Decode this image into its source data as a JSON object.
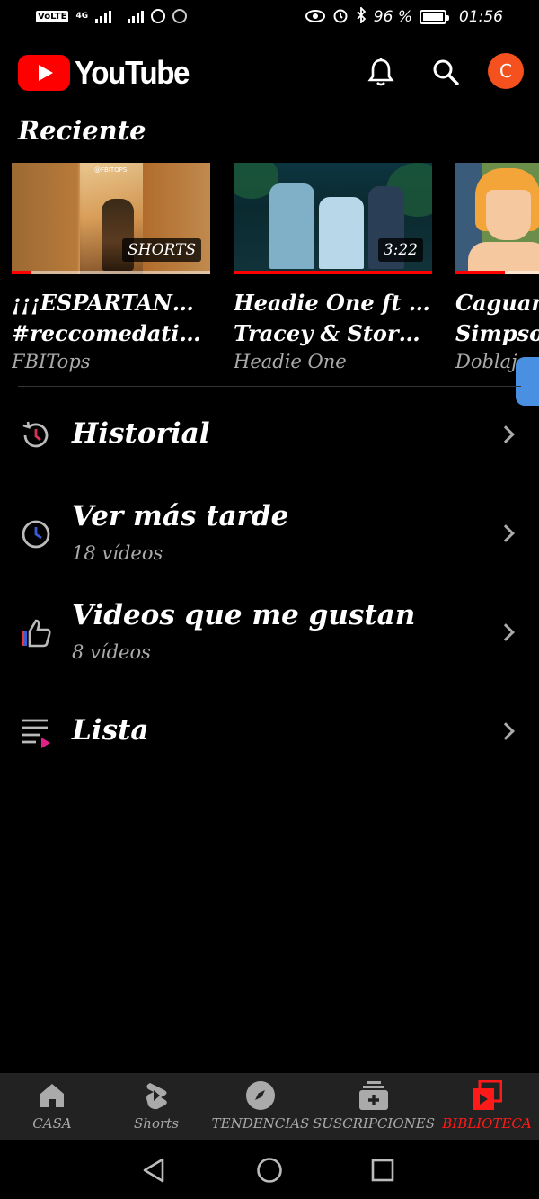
{
  "status_bar": {
    "volte": "VoLTE",
    "network": "4G",
    "battery_percent": "96 %",
    "time": "01:56"
  },
  "app_bar": {
    "logo_text": "YouTube",
    "avatar_initial": "C",
    "icons": [
      "bell-icon",
      "search-icon"
    ]
  },
  "recent": {
    "title": "Reciente",
    "videos": [
      {
        "title_line1": "¡¡¡ESPARTANOS!!!",
        "title_line2": "#reccomedation ...",
        "channel": "FBITops",
        "badge": "SHORTS",
        "watched_fraction": 0.1,
        "thumb_tag": "@FBITOPS"
      },
      {
        "title_line1": "Headie One ft AJ",
        "title_line2": "Tracey & Stormz...",
        "channel": "Headie One",
        "badge": "3:22",
        "watched_fraction": 1.0
      },
      {
        "title_line1": "Caguam",
        "title_line2": "Simpson",
        "channel": "Doblaje",
        "badge": "",
        "watched_fraction": 0.25
      }
    ]
  },
  "menu": [
    {
      "title": "Historial",
      "subtitle": "",
      "icon": "history-icon"
    },
    {
      "title": "Ver más tarde",
      "subtitle": "18 vídeos",
      "icon": "clock-icon"
    },
    {
      "title": "Videos que me gustan",
      "subtitle": "8 vídeos",
      "icon": "thumbs-up-icon"
    },
    {
      "title": "Lista",
      "subtitle": "",
      "icon": "playlist-icon"
    }
  ],
  "bottom_nav": [
    {
      "label": "CASA",
      "icon": "home-icon",
      "active": false
    },
    {
      "label": "Shorts",
      "icon": "shorts-icon",
      "active": false
    },
    {
      "label": "TENDENCIAS",
      "icon": "explore-icon",
      "active": false
    },
    {
      "label": "SUSCRIPCIONES",
      "icon": "subscriptions-icon",
      "active": false
    },
    {
      "label": "BIBLIOTECA",
      "icon": "library-icon",
      "active": true
    }
  ],
  "colors": {
    "brand_red": "#ff0000",
    "active_tab": "#ff1a1a",
    "avatar_bg": "#f4511e",
    "nav_bg": "#222222",
    "secondary_text": "#aaaaaa"
  }
}
